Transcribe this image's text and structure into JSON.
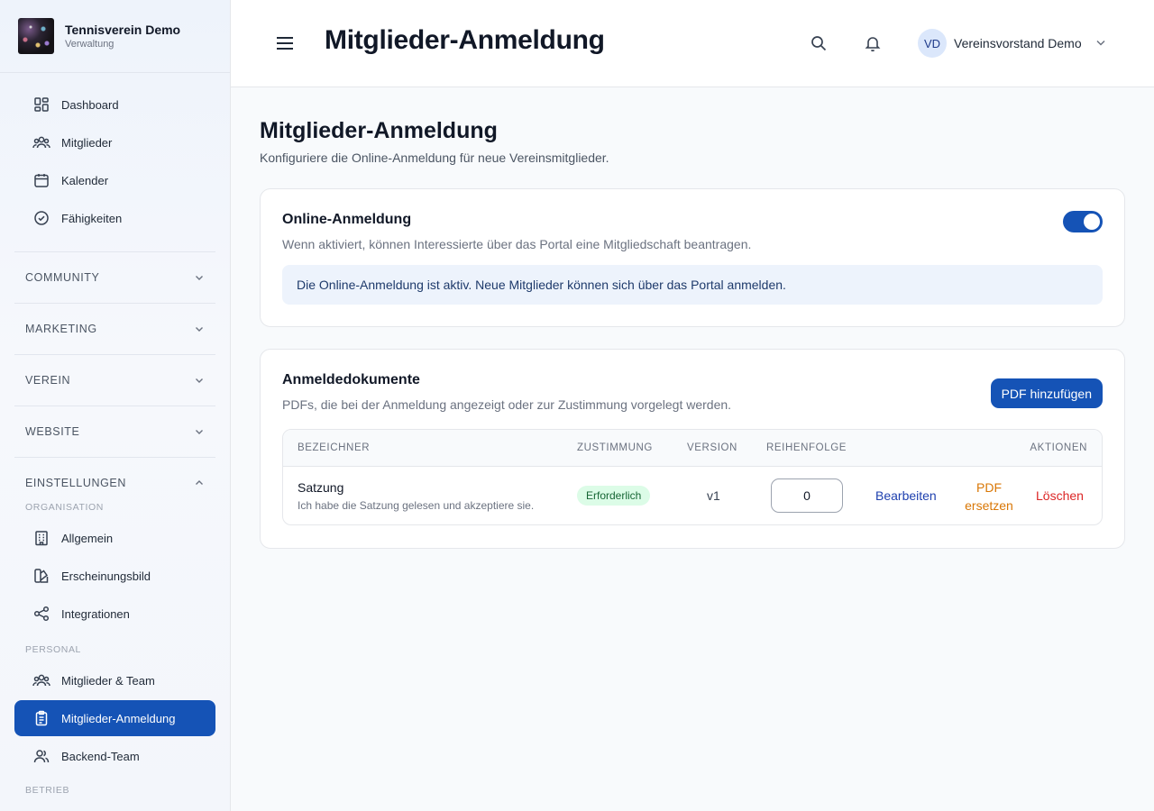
{
  "brand": {
    "title": "Tennisverein Demo",
    "subtitle": "Verwaltung"
  },
  "nav": {
    "top_items": [
      {
        "label": "Dashboard",
        "icon": "dashboard-icon"
      },
      {
        "label": "Mitglieder",
        "icon": "users-icon"
      },
      {
        "label": "Kalender",
        "icon": "calendar-icon"
      },
      {
        "label": "Fähigkeiten",
        "icon": "check-circle-icon"
      }
    ],
    "sections": [
      "COMMUNITY",
      "MARKETING",
      "VEREIN",
      "WEBSITE",
      "EINSTELLUNGEN"
    ],
    "subhead_org": "ORGANISATION",
    "org_items": [
      {
        "label": "Allgemein",
        "icon": "building-icon"
      },
      {
        "label": "Erscheinungsbild",
        "icon": "palette-icon"
      },
      {
        "label": "Integrationen",
        "icon": "share-icon"
      }
    ],
    "subhead_personal": "PERSONAL",
    "personal_items": [
      {
        "label": "Mitglieder & Team",
        "icon": "users-icon"
      },
      {
        "label": "Mitglieder-Anmeldung",
        "icon": "clipboard-icon",
        "active": true
      },
      {
        "label": "Backend-Team",
        "icon": "team-icon"
      }
    ],
    "subhead_betrieb": "BETRIEB"
  },
  "header": {
    "title": "Mitglieder-Anmeldung",
    "user_initials": "VD",
    "user_name": "Vereinsvorstand Demo"
  },
  "main": {
    "title": "Mitglieder-Anmeldung",
    "subtitle": "Konfiguriere die Online-Anmeldung für neue Vereinsmitglieder."
  },
  "online_card": {
    "title": "Online-Anmeldung",
    "description": "Wenn aktiviert, können Interessierte über das Portal eine Mitgliedschaft beantragen.",
    "enabled": true,
    "info": "Die Online-Anmeldung ist aktiv. Neue Mitglieder können sich über das Portal anmelden."
  },
  "docs_card": {
    "title": "Anmeldedokumente",
    "description": "PDFs, die bei der Anmeldung angezeigt oder zur Zustimmung vorgelegt werden.",
    "add_button": "PDF hinzufügen",
    "columns": [
      "BEZEICHNER",
      "ZUSTIMMUNG",
      "VERSION",
      "REIHENFOLGE",
      "AKTIONEN"
    ],
    "rows": [
      {
        "name": "Satzung",
        "description": "Ich habe die Satzung gelesen und akzeptiere sie.",
        "consent": "Erforderlich",
        "version": "v1",
        "order": "0",
        "edit": "Bearbeiten",
        "replace_line1": "PDF",
        "replace_line2": "ersetzen",
        "delete": "Löschen"
      }
    ]
  },
  "colors": {
    "primary": "#1553b6",
    "badge_bg": "#dcfce7",
    "badge_text": "#166534",
    "replace": "#d97706",
    "delete": "#dc2626"
  }
}
